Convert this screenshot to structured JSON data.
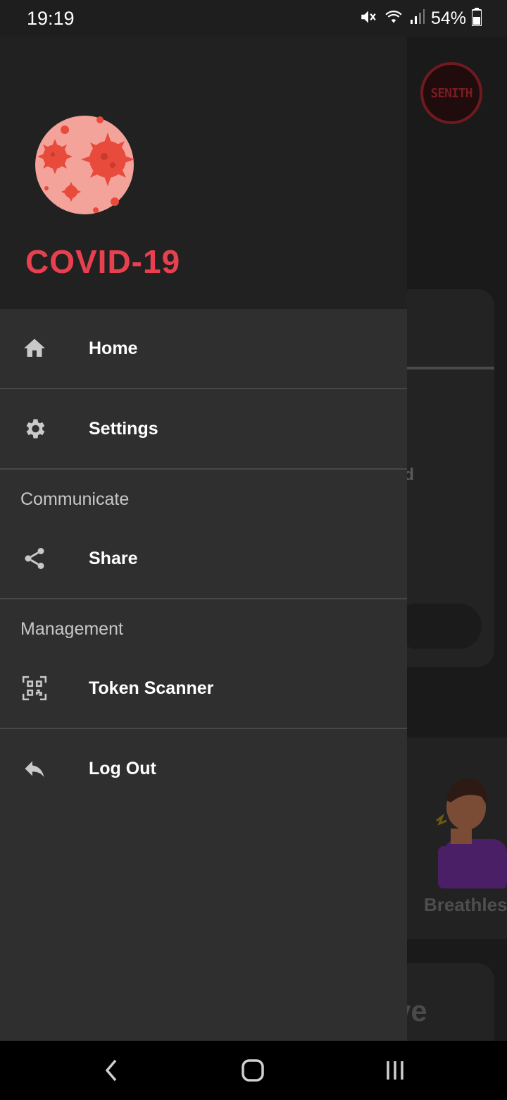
{
  "status_bar": {
    "time": "19:19",
    "battery_percent": "54%",
    "icons": [
      "mute-icon",
      "wifi-icon",
      "signal-icon",
      "battery-icon"
    ]
  },
  "background": {
    "logo_text": "SENITH",
    "partial_text": "ed",
    "card_caption": "Breathles",
    "partial_text_2": "ve"
  },
  "drawer": {
    "title": "COVID-19",
    "items": [
      {
        "label": "Home",
        "icon": "home-icon"
      },
      {
        "label": "Settings",
        "icon": "gear-icon"
      }
    ],
    "sections": [
      {
        "label": "Communicate",
        "items": [
          {
            "label": "Share",
            "icon": "share-icon"
          }
        ]
      },
      {
        "label": "Management",
        "items": [
          {
            "label": "Token Scanner",
            "icon": "qr-code-icon"
          }
        ]
      }
    ],
    "footer_item": {
      "label": "Log Out",
      "icon": "reply-icon"
    }
  },
  "colors": {
    "accent": "#e8404f",
    "drawer_bg": "#2f2f2f",
    "header_bg": "#212121"
  }
}
